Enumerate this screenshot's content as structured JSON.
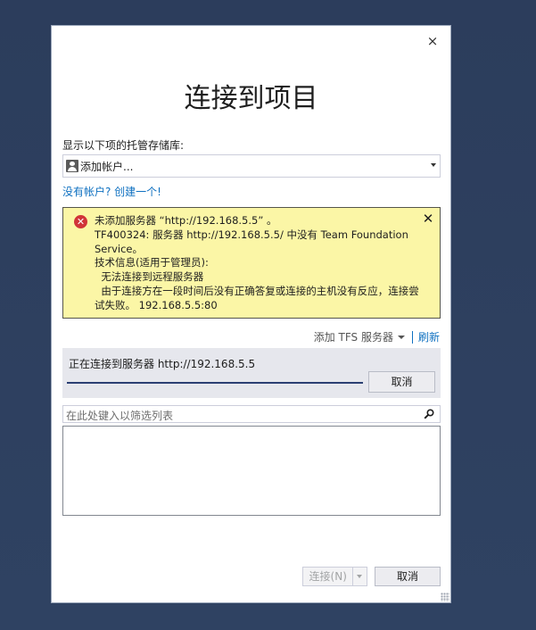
{
  "dialog": {
    "close_glyph": "×",
    "title": "连接到项目",
    "repos_label": "显示以下项的托管存储库:",
    "account_select": {
      "value": "添加帐户..."
    },
    "create_link": "没有帐户? 创建一个!",
    "error": {
      "close_glyph": "✕",
      "icon_glyph": "✕",
      "lines": [
        "未添加服务器 “http://192.168.5.5” 。",
        "TF400324: 服务器 http://192.168.5.5/ 中没有 Team Foundation Service。",
        "技术信息(适用于管理员):",
        "  无法连接到远程服务器",
        "  由于连接方在一段时间后没有正确答复或连接的主机没有反应，连接尝试失败。 192.168.5.5:80"
      ]
    },
    "toolbar": {
      "add_tfs": "添加 TFS 服务器",
      "refresh": "刷新"
    },
    "progress": {
      "label": "正在连接到服务器 http://192.168.5.5",
      "fraction": 1.0,
      "cancel": "取消"
    },
    "filter": {
      "placeholder": "在此处键入以筛选列表",
      "value": ""
    },
    "footer": {
      "connect": "连接(N)",
      "cancel": "取消"
    }
  },
  "colors": {
    "desktop": "#2c3d5c",
    "error_background": "#fbf6a6",
    "error_icon": "#d13438",
    "link": "#0e70c0",
    "progress_fill": "#2b3f73"
  }
}
